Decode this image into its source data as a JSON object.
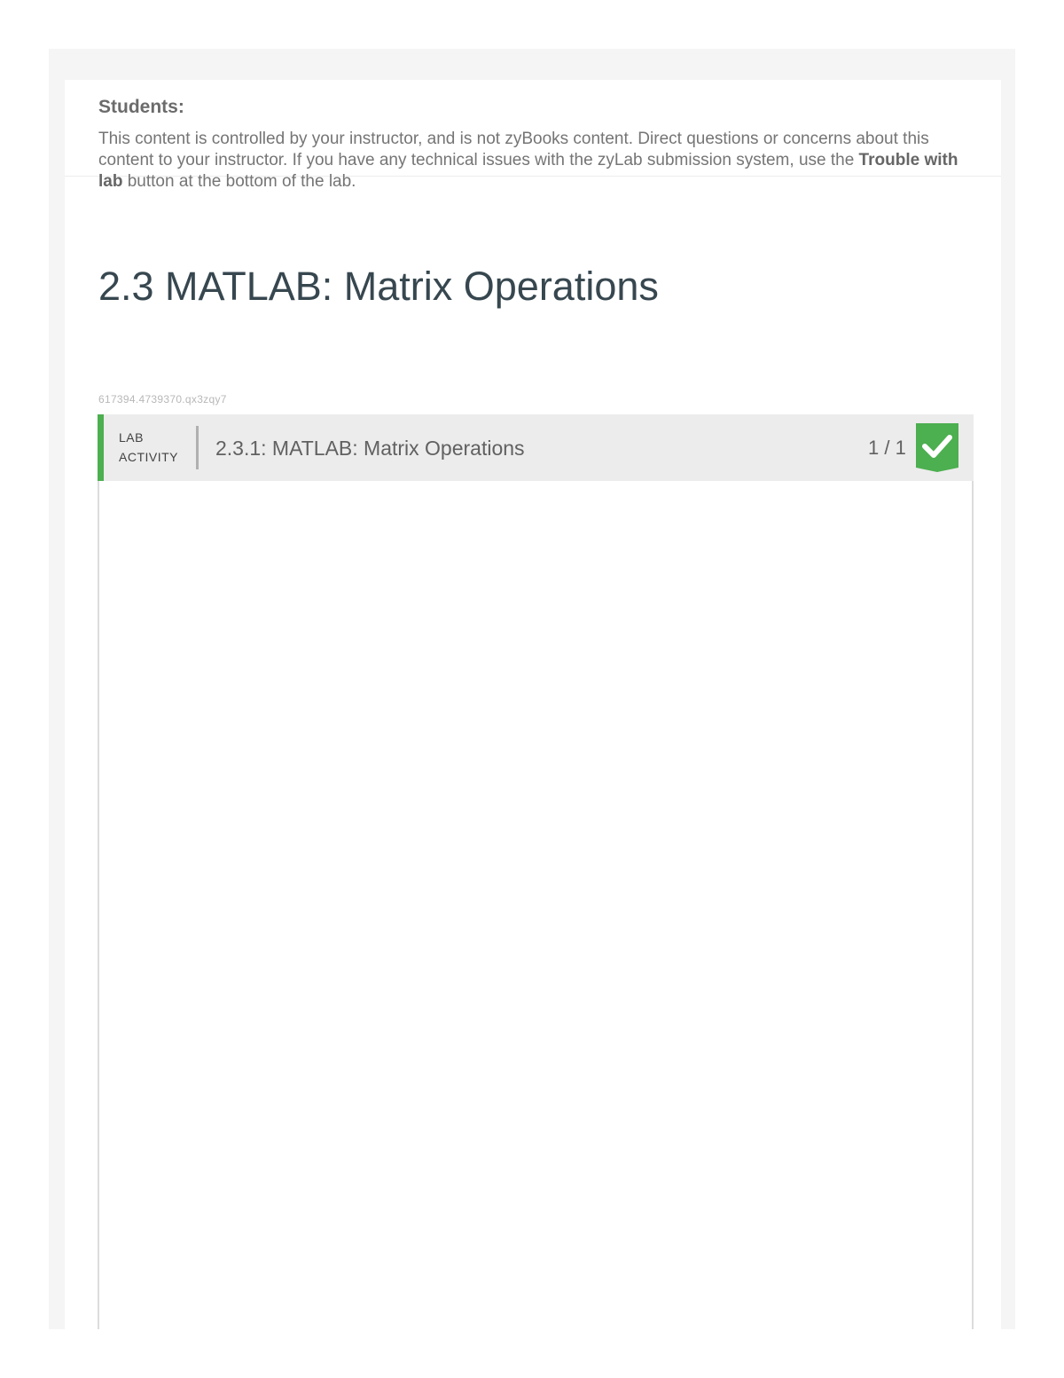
{
  "notice": {
    "title": "Students:",
    "text_before": "This content is controlled by your instructor, and is not zyBooks content. Direct questions or concerns about this content to your instructor. If you have any technical issues with the zyLab submission system, use the ",
    "bold_text": "Trouble with lab",
    "text_after": " button at the bottom of the lab."
  },
  "section": {
    "title": "2.3 MATLAB: Matrix Operations",
    "activity_id": "617394.4739370.qx3zqy7"
  },
  "lab": {
    "type_line1": "LAB",
    "type_line2": "ACTIVITY",
    "name": "2.3.1: MATLAB: Matrix Operations",
    "score": "1 / 1",
    "status_icon": "checkmark-icon",
    "accent_color": "#4caf50",
    "completed": true
  }
}
